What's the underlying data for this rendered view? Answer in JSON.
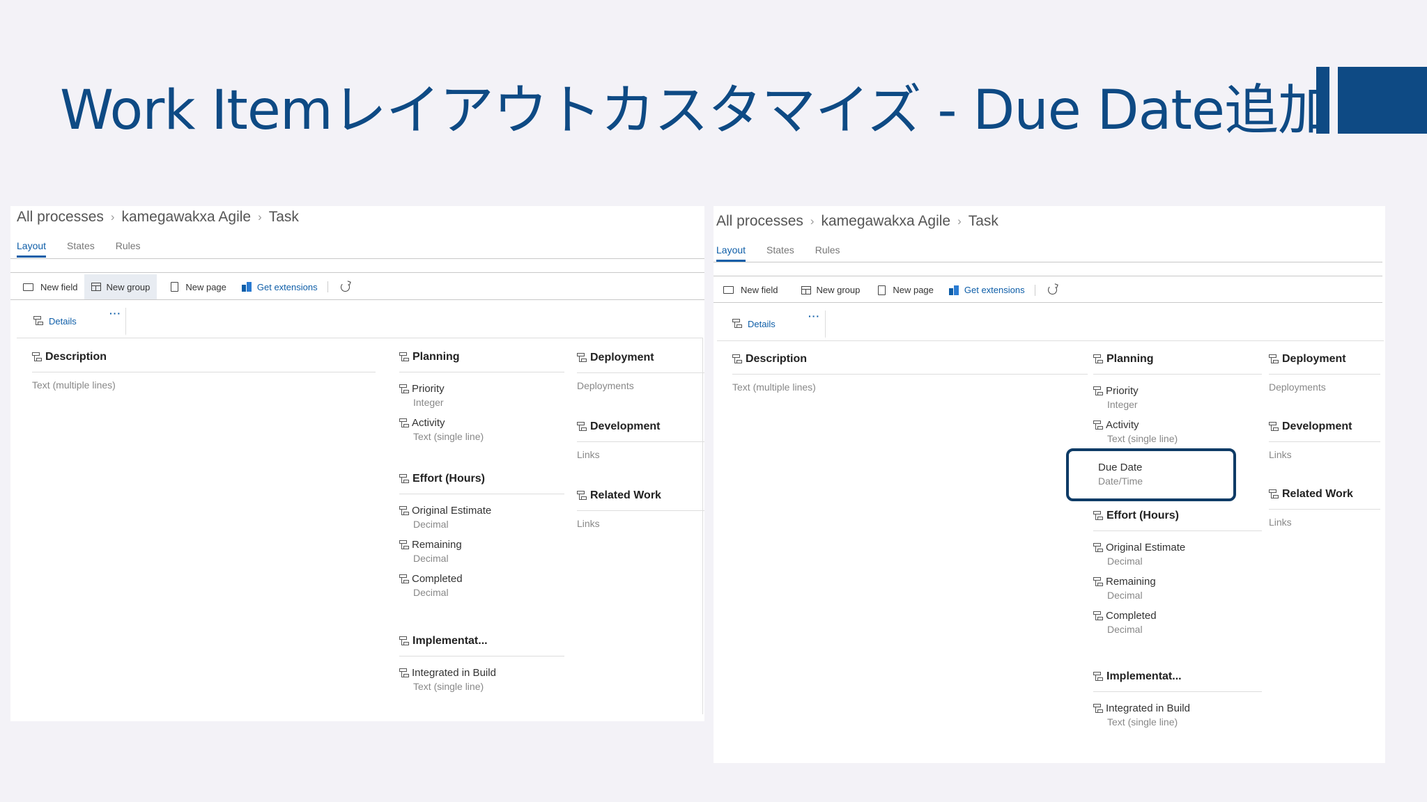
{
  "slide": {
    "title": "Work Itemレイアウトカスタマイズ - Due Date追加"
  },
  "shared": {
    "breadcrumb": [
      "All processes",
      "kamegawakxa Agile",
      "Task"
    ],
    "tabs": [
      "Layout",
      "States",
      "Rules"
    ],
    "toolbar": {
      "new_field": "New field",
      "new_group": "New group",
      "new_page": "New page",
      "get_extensions": "Get extensions"
    },
    "page_tab": "Details",
    "more": "···"
  },
  "left": {
    "description": {
      "title": "Description",
      "type": "Text (multiple lines)"
    },
    "planning": {
      "title": "Planning",
      "fields": [
        {
          "name": "Priority",
          "type": "Integer"
        },
        {
          "name": "Activity",
          "type": "Text (single line)"
        }
      ]
    },
    "effort": {
      "title": "Effort (Hours)",
      "fields": [
        {
          "name": "Original Estimate",
          "type": "Decimal"
        },
        {
          "name": "Remaining",
          "type": "Decimal"
        },
        {
          "name": "Completed",
          "type": "Decimal"
        }
      ]
    },
    "implementation": {
      "title": "Implementat...",
      "fields": [
        {
          "name": "Integrated in Build",
          "type": "Text (single line)"
        }
      ]
    },
    "deployment": {
      "title": "Deployment",
      "type": "Deployments"
    },
    "development": {
      "title": "Development",
      "type": "Links"
    },
    "related": {
      "title": "Related Work",
      "type": "Links"
    }
  },
  "right": {
    "description": {
      "title": "Description",
      "type": "Text (multiple lines)"
    },
    "planning": {
      "title": "Planning",
      "fields": [
        {
          "name": "Priority",
          "type": "Integer"
        },
        {
          "name": "Activity",
          "type": "Text (single line)"
        }
      ]
    },
    "due_date": {
      "name": "Due Date",
      "type": "Date/Time"
    },
    "effort": {
      "title": "Effort (Hours)",
      "fields": [
        {
          "name": "Original Estimate",
          "type": "Decimal"
        },
        {
          "name": "Remaining",
          "type": "Decimal"
        },
        {
          "name": "Completed",
          "type": "Decimal"
        }
      ]
    },
    "implementation": {
      "title": "Implementat...",
      "fields": [
        {
          "name": "Integrated in Build",
          "type": "Text (single line)"
        }
      ]
    },
    "deployment": {
      "title": "Deployment",
      "type": "Deployments"
    },
    "development": {
      "title": "Development",
      "type": "Links"
    },
    "related": {
      "title": "Related Work",
      "type": "Links"
    }
  }
}
